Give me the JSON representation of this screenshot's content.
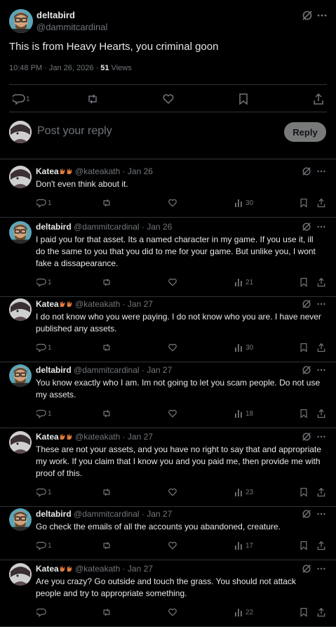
{
  "main": {
    "author_name": "deltabird",
    "author_handle": "@dammitcardinal",
    "text": "This is from Heavy Hearts, you criminal goon",
    "time": "10:48 PM · Jan 26, 2026 · ",
    "views_count": "51",
    "views_label": " Views",
    "reply_count": "1"
  },
  "composer": {
    "placeholder": "Post your reply",
    "button": "Reply"
  },
  "replies": [
    {
      "name": "Katea",
      "handle": "@kateakath",
      "date": "· Jan 26",
      "text": "Don't even think about it.",
      "replies": "1",
      "views": "30"
    },
    {
      "name": "deltabird",
      "handle": "@dammitcardinal",
      "date": "· Jan 26",
      "text": "I paid you for that asset. Its a named character in my game. If you use it, ill do the same to you that you did to me for your game. But unlike you, I wont fake a dissapearance.",
      "replies": "1",
      "views": "21"
    },
    {
      "name": "Katea",
      "handle": "@kateakath",
      "date": "· Jan 27",
      "text": "I do not know who you were paying. I do not know who you are. I have never published any assets.",
      "replies": "1",
      "views": "30"
    },
    {
      "name": "deltabird",
      "handle": "@dammitcardinal",
      "date": "· Jan 27",
      "text": "You know exactly who I am. Im not going to let you scam people. Do not use my assets.",
      "replies": "1",
      "views": "18"
    },
    {
      "name": "Katea",
      "handle": "@kateakath",
      "date": "· Jan 27",
      "text": "These are not your assets, and you have no right to say that and appropriate my work. If you claim that I know you and you paid me, then provide me with proof of this.",
      "replies": "1",
      "views": "23"
    },
    {
      "name": "deltabird",
      "handle": "@dammitcardinal",
      "date": "· Jan 27",
      "text": "Go check the emails of all the accounts you abandoned, creature.",
      "replies": "1",
      "views": "17"
    },
    {
      "name": "Katea",
      "handle": "@kateakath",
      "date": "· Jan 27",
      "text": "Are you crazy? Go outside and touch the grass. You should not attack people and try to appropriate something.",
      "replies": "",
      "views": "22"
    }
  ]
}
